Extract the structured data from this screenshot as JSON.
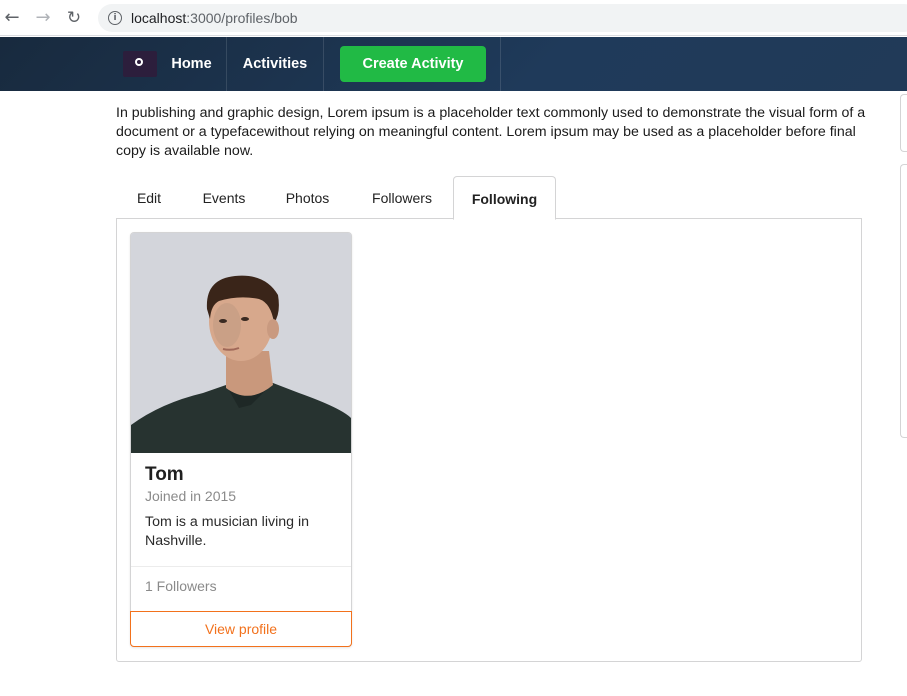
{
  "browser": {
    "back_icon": "arrow-left-icon",
    "forward_icon": "arrow-right-icon",
    "reload_icon": "reload-icon",
    "info_icon": "info-icon",
    "url_host": "localhost",
    "url_path": ":3000/profiles/bob"
  },
  "navbar": {
    "logo_icon": "logo-icon",
    "home_label": "Home",
    "activities_label": "Activities",
    "create_label": "Create Activity",
    "create_color": "#21ba45"
  },
  "profile": {
    "bio": "In publishing and graphic design, Lorem ipsum is a placeholder text commonly used to demonstrate the visual form of a document or a typefacewithout relying on meaningful content. Lorem ipsum may be used as a placeholder before final copy is available now."
  },
  "tabs": [
    {
      "label": "Edit",
      "active": false
    },
    {
      "label": "Events",
      "active": false
    },
    {
      "label": "Photos",
      "active": false
    },
    {
      "label": "Followers",
      "active": false
    },
    {
      "label": "Following",
      "active": true
    }
  ],
  "following": [
    {
      "name": "Tom",
      "joined": "Joined in 2015",
      "description": "Tom is a musician living in Nashville.",
      "followers": "1 Followers",
      "button_label": "View profile",
      "button_color": "#f2711c"
    }
  ]
}
